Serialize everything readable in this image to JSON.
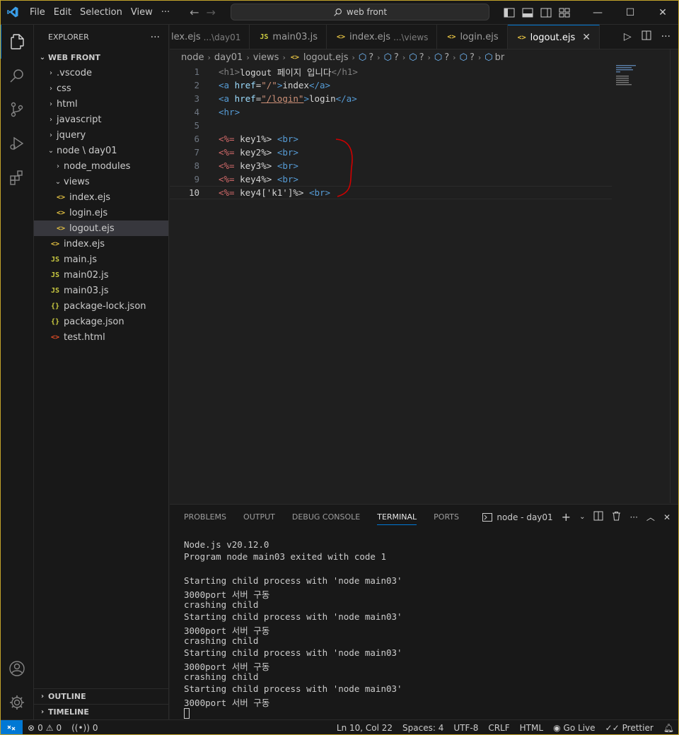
{
  "menu": [
    "File",
    "Edit",
    "Selection",
    "View",
    "···"
  ],
  "search": {
    "text": "web front"
  },
  "sidebar": {
    "title": "EXPLORER",
    "more": "···",
    "root": "WEB FRONT",
    "items": [
      {
        "label": ".vscode",
        "type": "folder"
      },
      {
        "label": "css",
        "type": "folder"
      },
      {
        "label": "html",
        "type": "folder"
      },
      {
        "label": "javascript",
        "type": "folder"
      },
      {
        "label": "jquery",
        "type": "folder"
      },
      {
        "label": "node \\ day01",
        "type": "folder-open"
      },
      {
        "label": "node_modules",
        "type": "folder"
      },
      {
        "label": "views",
        "type": "folder-open"
      },
      {
        "label": "index.ejs",
        "type": "ejs"
      },
      {
        "label": "login.ejs",
        "type": "ejs"
      },
      {
        "label": "logout.ejs",
        "type": "ejs"
      },
      {
        "label": "index.ejs",
        "type": "ejs"
      },
      {
        "label": "main.js",
        "type": "js"
      },
      {
        "label": "main02.js",
        "type": "js"
      },
      {
        "label": "main03.js",
        "type": "js"
      },
      {
        "label": "package-lock.json",
        "type": "json"
      },
      {
        "label": "package.json",
        "type": "json"
      },
      {
        "label": "test.html",
        "type": "html"
      }
    ],
    "outline": "OUTLINE",
    "timeline": "TIMELINE"
  },
  "tabs": [
    {
      "label": "lex.ejs",
      "desc": "...\\day01"
    },
    {
      "label": "main03.js",
      "desc": ""
    },
    {
      "label": "index.ejs",
      "desc": "...\\views"
    },
    {
      "label": "login.ejs",
      "desc": ""
    },
    {
      "label": "logout.ejs",
      "desc": ""
    }
  ],
  "breadcrumb": [
    "node",
    "day01",
    "views",
    "logout.ejs",
    "?",
    "?",
    "?",
    "?",
    "?",
    "br"
  ],
  "editor": {
    "line_numbers": [
      "1",
      "2",
      "3",
      "4",
      "5",
      "6",
      "7",
      "8",
      "9",
      "10"
    ],
    "line1": {
      "open": "<h1>",
      "text": "logout 페이지 입니다",
      "close": "</h1>"
    },
    "line2": {
      "a": "<a",
      "attr": " href",
      "eq": "=",
      "val": "\"/\"",
      "gt": ">",
      "text": "index",
      "close": "</a>"
    },
    "line3": {
      "a": "<a",
      "attr": " href",
      "eq": "=",
      "val": "\"/login\"",
      "gt": ">",
      "text": "login",
      "close": "</a>"
    },
    "line4": {
      "hr": "<hr>"
    },
    "ejs_lines": [
      {
        "open": "<%=",
        "expr": " key1",
        "close": "%>",
        "br": "<br>"
      },
      {
        "open": "<%=",
        "expr": " key2",
        "close": "%>",
        "br": "<br>"
      },
      {
        "open": "<%=",
        "expr": " key3",
        "close": "%>",
        "br": "<br>"
      },
      {
        "open": "<%=",
        "expr": " key4",
        "close": "%>",
        "br": "<br>"
      },
      {
        "open": "<%=",
        "expr": " key4['k1']",
        "close": "%>",
        "br": "<br>"
      }
    ]
  },
  "panel": {
    "tabs": [
      "PROBLEMS",
      "OUTPUT",
      "DEBUG CONSOLE",
      "TERMINAL",
      "PORTS"
    ],
    "terminal_name": "node - day01",
    "lines": [
      "Node.js v20.12.0",
      "Program node main03 exited with code 1",
      "",
      "Starting child process with 'node main03'",
      "3000port 서버 구동",
      "crashing child",
      "Starting child process with 'node main03'",
      "3000port 서버 구동",
      "crashing child",
      "Starting child process with 'node main03'",
      "3000port 서버 구동",
      "crashing child",
      "Starting child process with 'node main03'",
      "3000port 서버 구동"
    ]
  },
  "status": {
    "errors": "0",
    "warnings": "0",
    "ports": "0",
    "position": "Ln 10, Col 22",
    "spaces": "Spaces: 4",
    "encoding": "UTF-8",
    "eol": "CRLF",
    "language": "HTML",
    "golive": "Go Live",
    "prettier": "Prettier"
  },
  "colors": {
    "accent": "#0078d4",
    "annotation": "#d00000",
    "border_highlight": "#c2a32a"
  }
}
